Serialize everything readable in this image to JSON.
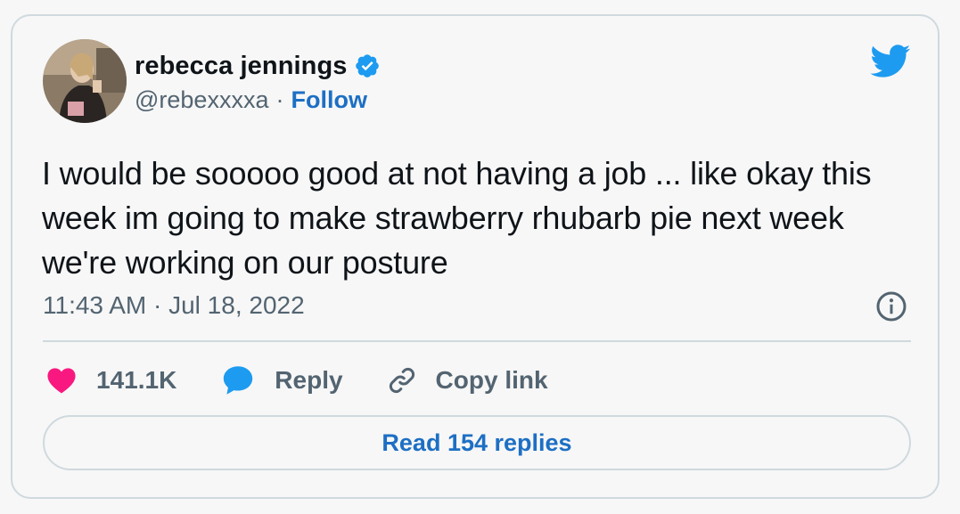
{
  "author": {
    "display_name": "rebecca jennings",
    "handle": "@rebexxxxa",
    "separator": "·",
    "follow_label": "Follow",
    "verified": true
  },
  "tweet": {
    "text": "I would be sooooo good at not having a job ... like okay this week im going to make strawberry rhubarb pie next week we're working on our posture",
    "timestamp": "11:43 AM · Jul 18, 2022"
  },
  "actions": {
    "like_count": "141.1K",
    "reply_label": "Reply",
    "copy_link_label": "Copy link"
  },
  "footer": {
    "read_replies_label": "Read 154 replies"
  },
  "icons": {
    "logo": "twitter-bird-icon",
    "verified": "verified-badge-icon",
    "info": "info-icon",
    "like": "heart-icon",
    "reply": "speech-bubble-icon",
    "copy_link": "link-icon"
  },
  "colors": {
    "text_primary": "#0f1419",
    "text_secondary": "#536471",
    "accent_blue": "#1d6fc4",
    "twitter_blue": "#1d9bf0",
    "like_pink": "#f91880",
    "border": "#cfd9de",
    "background": "#f7f7f7"
  }
}
